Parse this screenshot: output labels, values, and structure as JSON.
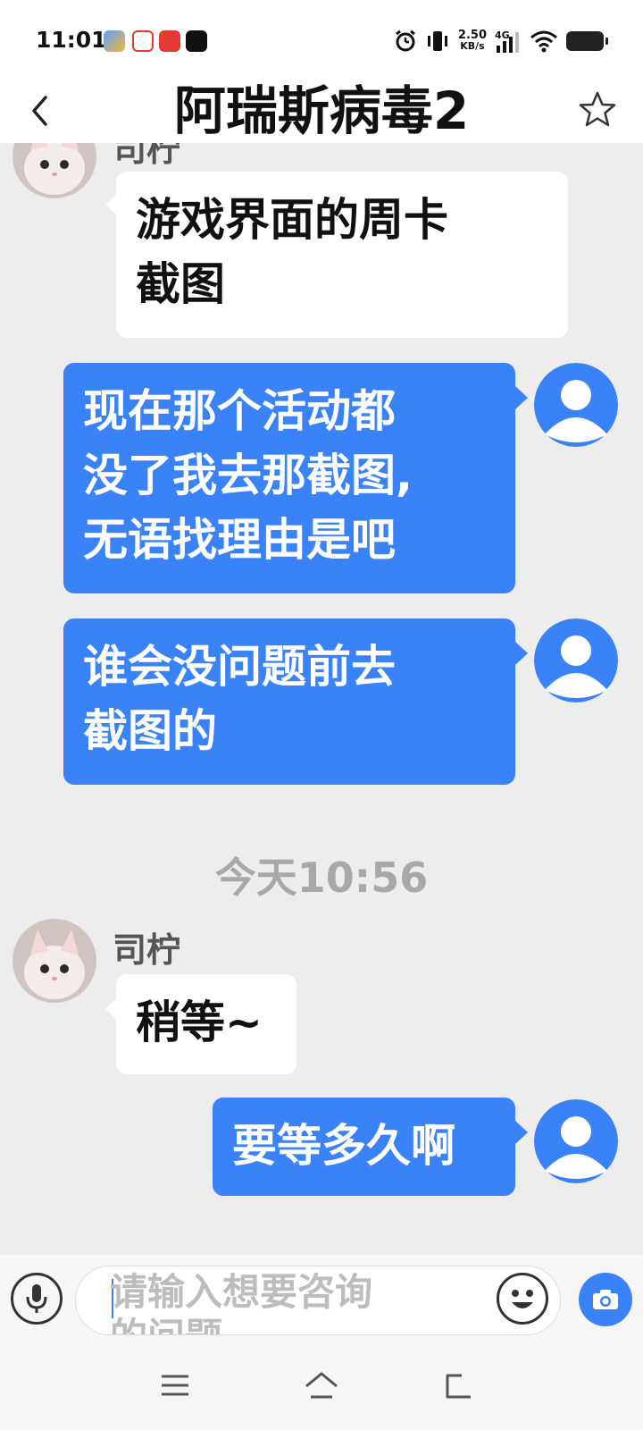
{
  "status_bar": {
    "time": "11:01",
    "net_speed_value": "2.50",
    "net_speed_unit": "KB/s",
    "network": "4G"
  },
  "header": {
    "title": "阿瑞斯病毒2"
  },
  "messages": [
    {
      "side": "left",
      "sender": "司柠",
      "lines": [
        "游戏界面的周卡",
        "截图"
      ]
    },
    {
      "side": "right",
      "lines": [
        "现在那个活动都",
        "没了我去那截图,",
        "无语找理由是吧"
      ]
    },
    {
      "side": "right",
      "lines": [
        "谁会没问题前去",
        "截图的"
      ]
    },
    {
      "side": "left",
      "sender": "司柠",
      "lines": [
        "稍等~"
      ]
    },
    {
      "side": "right",
      "lines": [
        "要等多久啊"
      ]
    }
  ],
  "timestamp": "今天10:56",
  "input": {
    "placeholder_line1": "请输入想要咨询",
    "placeholder_line2": "的问题"
  },
  "colors": {
    "accent": "#3a82f7",
    "background": "#ededed",
    "bubble_left": "#ffffff",
    "bubble_right": "#3a82f7"
  }
}
